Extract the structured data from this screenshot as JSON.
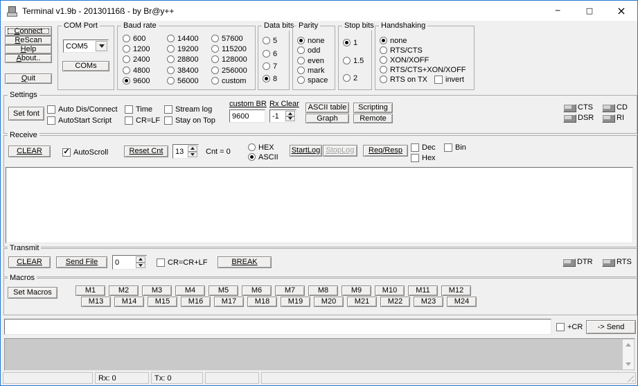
{
  "window": {
    "title": "Terminal v1.9b - 20130116ß - by Br@y++"
  },
  "icons": {
    "minimize": "─",
    "maximize": "□",
    "close": "×",
    "check": "✓"
  },
  "colors": {
    "window_border": "#2576d5",
    "titlebar_bg": "#ffffff",
    "background": "#f0f0f0",
    "display_bg": "#ffffff",
    "history_bg": "#c9c9c9",
    "disabled_text": "#9b9b9b"
  },
  "sidebar": {
    "connect": "Connect",
    "rescan": "ReScan",
    "help": "Help",
    "about": "About..",
    "quit": "Quit"
  },
  "com_port": {
    "title": "COM Port",
    "selected": "COM5",
    "coms": "COMs"
  },
  "baud": {
    "title": "Baud rate",
    "selected": "9600",
    "col1": [
      "600",
      "1200",
      "2400",
      "4800",
      "9600"
    ],
    "col2": [
      "14400",
      "19200",
      "28800",
      "38400",
      "56000"
    ],
    "col3": [
      "57600",
      "115200",
      "128000",
      "256000",
      "custom"
    ]
  },
  "data_bits": {
    "title": "Data bits",
    "options": [
      "5",
      "6",
      "7",
      "8"
    ],
    "selected": "8"
  },
  "parity": {
    "title": "Parity",
    "options": [
      "none",
      "odd",
      "even",
      "mark",
      "space"
    ],
    "selected": "none"
  },
  "stop_bits": {
    "title": "Stop bits",
    "options": [
      "1",
      "1.5",
      "2"
    ],
    "selected": "1"
  },
  "handshaking": {
    "title": "Handshaking",
    "options": [
      "none",
      "RTS/CTS",
      "XON/XOFF",
      "RTS/CTS+XON/XOFF",
      "RTS on TX"
    ],
    "selected": "none",
    "invert": "invert"
  },
  "settings": {
    "title": "Settings",
    "set_font": "Set font",
    "auto_disconnect": "Auto Dis/Connect",
    "autostart": "AutoStart Script",
    "time": "Time",
    "crlf": "CR=LF",
    "stream_log": "Stream log",
    "stay_on_top": "Stay on Top",
    "custom_br_label": "custom BR",
    "custom_br_value": "9600",
    "rx_clear_label": "Rx Clear",
    "rx_clear_value": "-1",
    "ascii_table": "ASCII table",
    "graph": "Graph",
    "scripting": "Scripting",
    "remote": "Remote"
  },
  "leds": {
    "cts": "CTS",
    "dsr": "DSR",
    "cd": "CD",
    "ri": "RI",
    "dtr": "DTR",
    "rts": "RTS"
  },
  "receive": {
    "title": "Receive",
    "clear": "CLEAR",
    "autoscroll": "AutoScroll",
    "reset_cnt": "Reset Cnt",
    "counter": "13",
    "cnt_text": "Cnt = 0",
    "hex": "HEX",
    "ascii": "ASCII",
    "mode_selected": "ASCII",
    "startlog": "StartLog",
    "stoplog": "StopLog",
    "reqresp": "Req/Resp",
    "dec": "Dec",
    "hex2": "Hex",
    "bin": "Bin",
    "content": ""
  },
  "transmit": {
    "title": "Transmit",
    "clear": "CLEAR",
    "send_file": "Send File",
    "spin": "0",
    "crcrlf": "CR=CR+LF",
    "break_btn": "BREAK"
  },
  "macros": {
    "title": "Macros",
    "set_macros": "Set Macros",
    "buttons": [
      "M1",
      "M2",
      "M3",
      "M4",
      "M5",
      "M6",
      "M7",
      "M8",
      "M9",
      "M10",
      "M11",
      "M12",
      "M13",
      "M14",
      "M15",
      "M16",
      "M17",
      "M18",
      "M19",
      "M20",
      "M21",
      "M22",
      "M23",
      "M24"
    ]
  },
  "send_line": {
    "value": "",
    "plus_cr": "+CR",
    "send": "-> Send"
  },
  "statusbar": {
    "rx": "Rx: 0",
    "tx": "Tx: 0"
  }
}
